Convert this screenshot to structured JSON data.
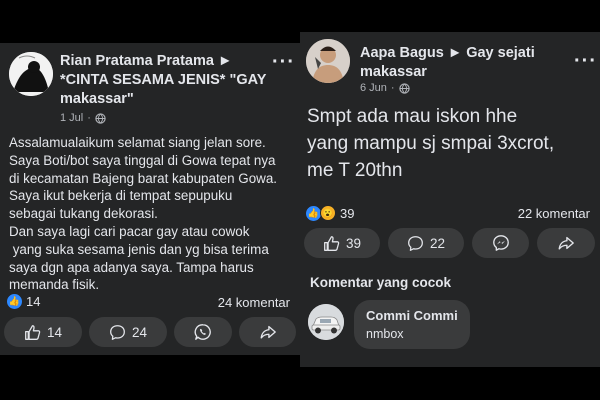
{
  "left_post": {
    "author": [
      "Rian Pratama Pratama ►",
      "*CINTA SESAMA JENIS* \"GAY",
      "makassar\""
    ],
    "time": "1 Jul",
    "meta_sep": "·",
    "body_lines": [
      "Assalamualaikum selamat siang jelan sore.",
      "Saya Boti/bot saya tinggal di Gowa tepat nya",
      "di kecamatan Bajeng barat kabupaten Gowa.",
      "Saya ikut bekerja di tempat sepupuku",
      "sebagai tukang dekorasi.",
      "Dan saya lagi cari pacar gay atau cowok",
      " yang suka sesama jenis dan yg bisa terima",
      "saya dgn apa adanya saya. Tampa harus",
      "memanda fisik."
    ],
    "reaction_count": "14",
    "comment_count": "24 komentar",
    "buttons": {
      "like": "14",
      "comment": "24"
    },
    "more": "···"
  },
  "right_post": {
    "author": [
      "Aapa Bagus ► Gay sejati",
      "makassar"
    ],
    "time": "6 Jun",
    "meta_sep": "·",
    "body_lines": [
      "Smpt ada mau iskon hhe",
      "yang mampu sj smpai 3xcrot,",
      "me T 20thn"
    ],
    "reaction_count": "39",
    "comment_count": "22 komentar",
    "buttons": {
      "like": "39",
      "comment": "22"
    },
    "more": "···",
    "comments_section_title": "Komentar yang cocok",
    "comment": {
      "name": "Commi Commi",
      "text": "nmbox"
    }
  },
  "colors": {
    "background": "#000000",
    "card": "#242526",
    "button": "#3a3b3c",
    "text": "#e4e6eb",
    "secondary_text": "#b0b3b8",
    "like_blue": "#2d88ff",
    "wow_yellow": "#f7b125"
  }
}
